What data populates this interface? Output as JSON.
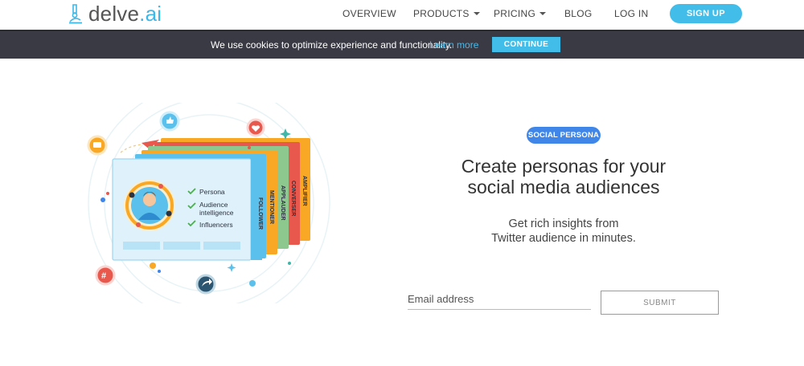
{
  "brand": {
    "name_main": "delve",
    "name_accent": ".ai",
    "accent_color": "#3db8e8"
  },
  "nav": {
    "items": [
      {
        "label": "OVERVIEW",
        "dropdown": false
      },
      {
        "label": "PRODUCTS",
        "dropdown": true
      },
      {
        "label": "PRICING",
        "dropdown": true
      },
      {
        "label": "BLOG",
        "dropdown": false
      },
      {
        "label": "LOG IN",
        "dropdown": false
      }
    ],
    "signup_label": "SIGN UP"
  },
  "cookie_bar": {
    "message": "We use cookies to optimize experience and functionality.",
    "link_label": "Learn more",
    "button_label": "CONTINUE"
  },
  "illustration": {
    "cards": [
      "FOLLOWER",
      "MENTIONER",
      "APPLAUDER",
      "CONVERSER",
      "AMPLIFIER"
    ],
    "features": [
      "Persona",
      "Audience",
      "intelligence",
      "Influencers"
    ]
  },
  "hero": {
    "badge": "SOCIAL PERSONA",
    "headline_line1": "Create personas for your",
    "headline_line2": "social media audiences",
    "sub_line1": "Get rich insights from",
    "sub_line2": "Twitter audience in minutes.",
    "email_placeholder": "Email address",
    "submit_label": "SUBMIT"
  },
  "colors": {
    "primary": "#42bde9",
    "badge": "#3f86e8",
    "cookie_bg": "#3a3a45"
  }
}
